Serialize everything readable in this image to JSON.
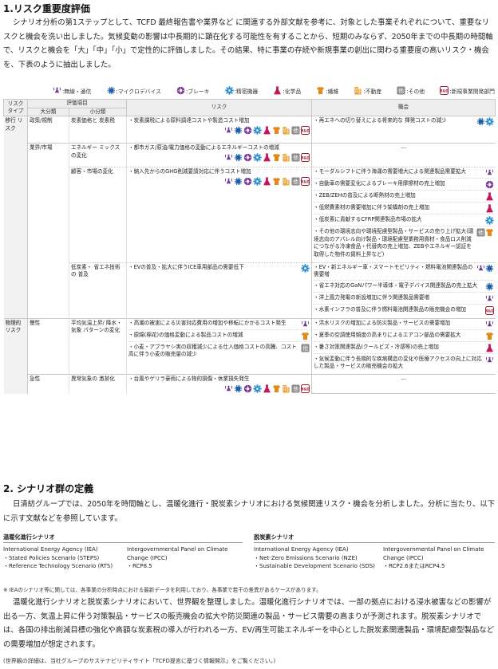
{
  "section1": {
    "title": "1.リスク重要度評価",
    "intro": "シナリオ分析の第1ステップとして、TCFD 最終報告書や業界など に関連する外部文献を参考に、対象とした事業それぞれについて、重要なリスクと機会を洗い出しました。気候変動の影響は中長期的に顕在化する可能性を有することから、短期のみならず、2050年までの中長期の時間軸で、リスクと機会を「大」「中」「小」で定性的に評価しました。その結果、特に事業の存続や新規事業の創出に関わる重要度の高いリスク・機会を、下表のように抽出しました。"
  },
  "legend": [
    {
      "icon": "wireless-icon",
      "label": ":無線・通信"
    },
    {
      "icon": "microdevice-icon",
      "label": ":マイクロデバイス"
    },
    {
      "icon": "brake-icon",
      "label": ":ブレーキ"
    },
    {
      "icon": "precision-gear-icon",
      "label": ":精密機器"
    },
    {
      "icon": "chemical-flask-icon",
      "label": ":化学品"
    },
    {
      "icon": "textile-shirt-icon",
      "label": ":繊維"
    },
    {
      "icon": "real-estate-icon",
      "label": ":不動産"
    },
    {
      "icon": "other-icon",
      "label": ":その他"
    },
    {
      "icon": "rnd-icon",
      "label": ":新規事業開発部門"
    }
  ],
  "icon_text": {
    "other": "他",
    "rnd": "R&D"
  },
  "colors": {
    "wireless": "#6d3b8e",
    "micro": "#1f5ea8",
    "brake": "#7d3c98",
    "gear": "#1e88c8",
    "chem": "#c2185b",
    "textile": "#e08a1e",
    "realestate": "#e8a23a",
    "other": "#8a8a8a",
    "rnd": "#9b1b30"
  },
  "table": {
    "headers": {
      "risk_type": "リスク タイプ",
      "eval_item": "評価項目",
      "large": "大分類",
      "small": "小分類",
      "risk": "リスク",
      "opportunity": "機会"
    },
    "types": {
      "transition": "移行 リスク",
      "physical": "物理的 リスク"
    },
    "large": {
      "policy": "政策/規制",
      "industry": "業界/市場",
      "chronic": "慢性",
      "acute": "急性"
    },
    "small": {
      "carbon": "炭素価格と 炭素税",
      "energy": "エネルギー ミックスの変化",
      "customer": "顧客・市場の変化",
      "lowcarbon": "低炭素・ 省エネ技術の 普及",
      "temp": "平均気温上昇/ 降水・気象 パターンの変化",
      "extreme": "異常気象の 激甚化"
    },
    "risks": {
      "r1": "・炭素課税による原料調達コストや製造コスト増加",
      "r2": "・都市ガス/原油/電力価格の変動によるエネルギーコストの増減",
      "r3": "・納入先からのGHG削減要請対応に伴うコスト増加",
      "r4": "・EVの普及・拡大に伴うICE車用部品の需要低下",
      "r5": "・高潮の被害による災害対応費用の増加や移転にかかるコスト発生",
      "r6": "・原綿(棉花)の価格変動による製品コストの増減",
      "r7": "・小麦・アブラヤシ実の収穫減少による仕入価格コストの高騰、コスト高に伴う小麦の販売量の減少",
      "r8": "・台風やゲリラ豪雨による物的損傷・休業損失発生"
    },
    "opps": {
      "o1": "・再エネへの切り替えによる将来的な 揮発コストの減少",
      "o2": "―",
      "o3": "・モーダルシフトに伴う海運の需要増大による関連製品需要拡大",
      "o4": "・自動車の需要変化によるブレーキ用摩擦材の売上増加",
      "o5": "・ZEB/ZEHの普及による断熱材の売上増加",
      "o6": "・低燃費素材の需要増加に伴う架橋剤の売上増加",
      "o7": "・低炭素に貢献するCFRP関連製品市場の拡大",
      "o8": "・その他の環境志向や環境配慮型製品・サービスの売り上げ拡大(環境志向のアパレル向け製品・環境配慮型業務用資材・食品ロス削減につながる冷凍食品・代替肉の売上増加、ZEBやエネルギー認証を取得した物件の賃料上昇など)",
      "o9": "・EV・新エネルギー車・スマートモビリティ・燃料電池関連製品の需要増",
      "o10": "・省エネ対応のGaNパワー半導体・電子デバイス関連製品の売上拡大",
      "o11": "・洋上風力発電の新設増加に伴う関連製品需要増",
      "o12": "・水素インフラの普及に伴う燃料電池関連製品の販売機会の増加",
      "o13": "・洪水リスクの増加による防災製品・サービスの需要増加",
      "o14": "・夏季の空調使用頻度の高まりによるエアコン部品の需要拡大",
      "o15": "・暑さ対策関連製品(クールビズ・冷感等)の売上増加",
      "o16": "・気候変動に伴う長期的な疾病構造の変化や医療アクセスの向上に対応した製品・サービスの販売機会の拡大",
      "o17": "―"
    }
  },
  "section2": {
    "title": "2. シナリオ群の定義",
    "p1": "日清紡グループでは、2050年を時間軸とし、温暖化進行・脱炭素シナリオにおける気候関連リスク・機会を分析しました。分析に当たり、以下に示す文献などを参照しています。",
    "warming": {
      "title": "温暖化進行シナリオ",
      "iea_org": "International Energy Agency (IEA)",
      "iea_items": [
        "・Stated Policies Scenario (STEPS)",
        "・Reference Technology Scenario (RTS)"
      ],
      "ipcc_org": "Intergovernmental Panel on Climate Change (IPCC)",
      "ipcc_items": [
        "・RCP8.5"
      ]
    },
    "decarb": {
      "title": "脱炭素シナリオ",
      "iea_org": "International Energy Agency (IEA)",
      "iea_items": [
        "・Net-Zero Emissions Scenario (NZE)",
        "・Sustainable Development Scenario (SDS)"
      ],
      "ipcc_org": "Intergovernmental Panel on Climate Change (IPCC)",
      "ipcc_items": [
        "・RCP2.6またはRCP4.5"
      ]
    },
    "note": "※ IEAのシナリオ等に関しては、各事業の分析時点における最新データを利用しており、各事業で若干の差異があるケースがあります。",
    "p2": "温暖化進行シナリオと脱炭素シナリオにおいて、世界観を整理しました。温暖化進行シナリオでは、一部の拠点における浸水被害などの影響が出る一方、気温上昇に伴う対策製品・サービスの販売機会の拡大や防災関連の製品・サービス需要の高まりが予測されます。脱炭素シナリオでは、各国の排出削減目標の強化や高額な炭素税の導入が行われる一方、EV/再生可能エネルギーを中心とした脱炭素関連製品・環境配慮型製品などの需要増加が想定されます。",
    "footnote": "(世界観の詳細は、当社グループのサステナビリティサイト「TCFD提言に基づく情報開示」をご覧ください。)"
  }
}
